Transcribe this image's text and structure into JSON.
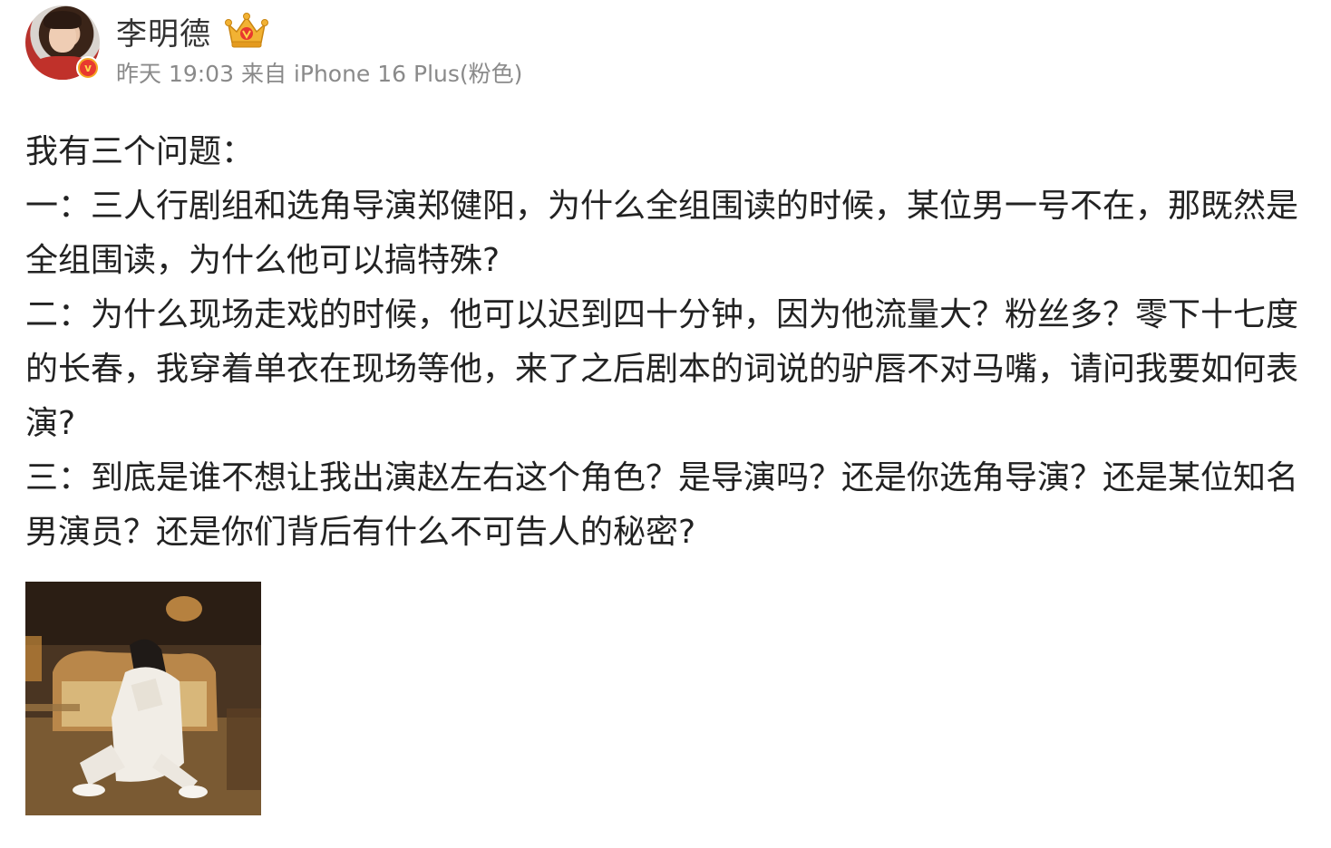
{
  "author": {
    "name": "李明德",
    "avatar_icon": "user-avatar",
    "verified_icon": "verified-v-badge-icon",
    "verified_letter": "v",
    "badge_icon": "crown-icon"
  },
  "post_meta": {
    "time": "昨天 19:03",
    "source_prefix": "来自",
    "device": "iPhone 16 Plus(粉色)"
  },
  "post_paragraphs": [
    "我有三个问题：",
    "一：三人行剧组和选角导演郑健阳，为什么全组围读的时候，某位男一号不在，那既然是全组围读，为什么他可以搞特殊?",
    "二：为什么现场走戏的时候，他可以迟到四十分钟，因为他流量大？粉丝多？零下十七度的长春，我穿着单衣在现场等他，来了之后剧本的词说的驴唇不对马嘴，请问我要如何表演?",
    "三：到底是谁不想让我出演赵左右这个角色？是导演吗？还是你选角导演？还是某位知名男演员？还是你们背后有什么不可告人的秘密?"
  ],
  "attached_image": {
    "icon": "photo-thumbnail"
  },
  "colors": {
    "text": "#222222",
    "meta": "#8a8a8a",
    "badge_orange": "#f5a623",
    "badge_red": "#e8392f",
    "crown_gold": "#f2b233"
  }
}
